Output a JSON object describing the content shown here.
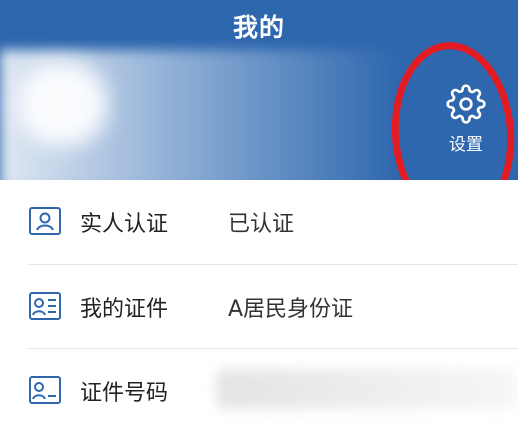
{
  "header": {
    "title": "我的"
  },
  "settings": {
    "label": "设置",
    "icon": "gear-icon"
  },
  "rows": [
    {
      "label": "实人认证",
      "value": "已认证",
      "icon": "id-card-icon"
    },
    {
      "label": "我的证件",
      "value": "A居民身份证",
      "icon": "id-card-list-icon"
    },
    {
      "label": "证件号码",
      "value": "",
      "icon": "id-card-number-icon"
    }
  ],
  "colors": {
    "header_bg": "#2e67ae",
    "annotation": "#e31b23",
    "text": "#222222"
  }
}
